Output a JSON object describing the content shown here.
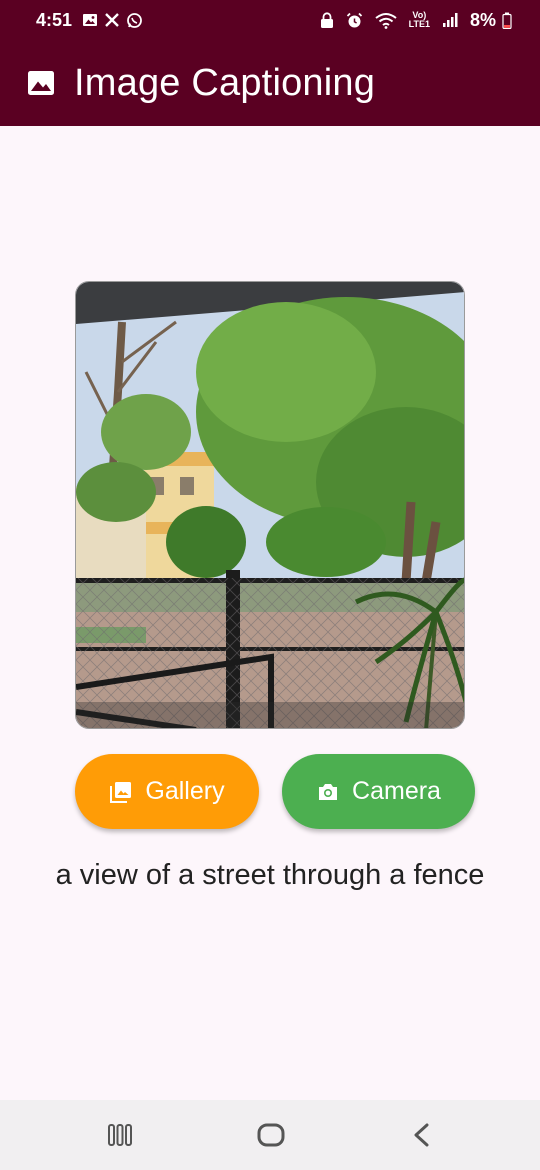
{
  "status_bar": {
    "time": "4:51",
    "network_label_top": "Vo)",
    "network_label_bottom": "LTE1",
    "battery": "8%",
    "icons": [
      "image-icon",
      "x-icon",
      "whatsapp-icon",
      "lock-icon",
      "alarm-icon",
      "wifi-icon",
      "signal-icon",
      "battery-icon"
    ]
  },
  "app_bar": {
    "title": "Image Captioning",
    "icon": "image-icon",
    "color": "#5a0022"
  },
  "photo": {
    "subject": "street view through a chain-link fence with trees and buildings"
  },
  "buttons": {
    "gallery": {
      "label": "Gallery",
      "icon": "photo-library-icon",
      "color": "#ff9c06"
    },
    "camera": {
      "label": "Camera",
      "icon": "camera-icon",
      "color": "#4caf50"
    }
  },
  "caption": "a view of a street through a fence",
  "nav_bar": {
    "items": [
      "recent-apps-icon",
      "home-icon",
      "back-icon"
    ]
  }
}
